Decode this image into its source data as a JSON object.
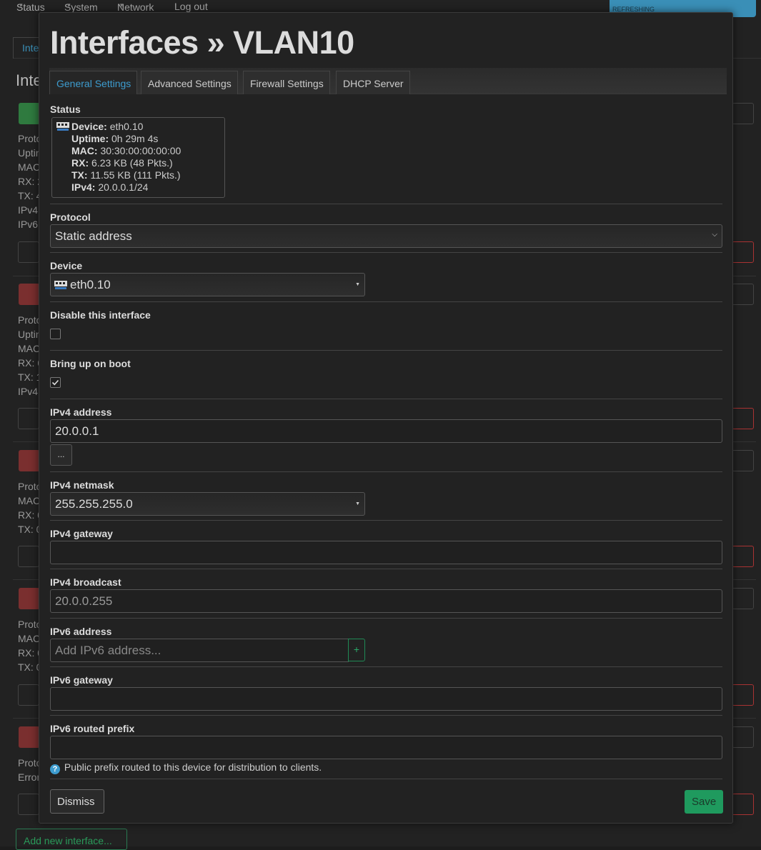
{
  "nav": {
    "items": [
      "Status",
      "System",
      "Network",
      "Log out"
    ],
    "refreshing": "REFRESHING"
  },
  "background": {
    "tab_label": "Inte",
    "heading": "Inte",
    "lines_a": [
      "Proto",
      "Uptin",
      "MAC",
      "RX: 2",
      "TX: 4",
      "IPv4",
      "IPv6"
    ],
    "lines_b": [
      "Proto",
      "Uptin",
      "MAC",
      "RX: 6",
      "TX: 1",
      "IPv4"
    ],
    "lines_c": [
      "Proto",
      "MAC",
      "RX: 0",
      "TX: 0"
    ],
    "lines_d": [
      "Proto",
      "MAC",
      "RX: 0",
      "TX: 0"
    ],
    "lines_e": [
      "Proto",
      "Error"
    ],
    "add_button": "Add new interface..."
  },
  "modal": {
    "title": "Interfaces » VLAN10",
    "tabs": [
      "General Settings",
      "Advanced Settings",
      "Firewall Settings",
      "DHCP Server"
    ],
    "status": {
      "label": "Status",
      "device_key": "Device:",
      "device_val": "eth0.10",
      "uptime_key": "Uptime:",
      "uptime_val": "0h 29m 4s",
      "mac_key": "MAC:",
      "mac_val": "30:30:00:00:00:00",
      "rx_key": "RX:",
      "rx_val": "6.23 KB (48 Pkts.)",
      "tx_key": "TX:",
      "tx_val": "11.55 KB (111 Pkts.)",
      "ipv4_key": "IPv4:",
      "ipv4_val": "20.0.0.1/24"
    },
    "protocol": {
      "label": "Protocol",
      "value": "Static address"
    },
    "device": {
      "label": "Device",
      "value": "eth0.10"
    },
    "disable": {
      "label": "Disable this interface",
      "checked": false
    },
    "boot": {
      "label": "Bring up on boot",
      "checked": true
    },
    "ipv4_address": {
      "label": "IPv4 address",
      "value": "20.0.0.1",
      "more": "..."
    },
    "ipv4_netmask": {
      "label": "IPv4 netmask",
      "value": "255.255.255.0"
    },
    "ipv4_gateway": {
      "label": "IPv4 gateway",
      "value": ""
    },
    "ipv4_broadcast": {
      "label": "IPv4 broadcast",
      "placeholder": "20.0.0.255"
    },
    "ipv6_address": {
      "label": "IPv6 address",
      "placeholder": "Add IPv6 address...",
      "add": "+"
    },
    "ipv6_gateway": {
      "label": "IPv6 gateway",
      "value": ""
    },
    "ipv6_prefix": {
      "label": "IPv6 routed prefix",
      "value": "",
      "help": "Public prefix routed to this device for distribution to clients.",
      "help_icon": "?"
    },
    "dismiss": "Dismiss",
    "save": "Save"
  },
  "colors": {
    "accent": "#3d9ccf",
    "save": "#1f9a5e",
    "danger": "#a33333"
  }
}
